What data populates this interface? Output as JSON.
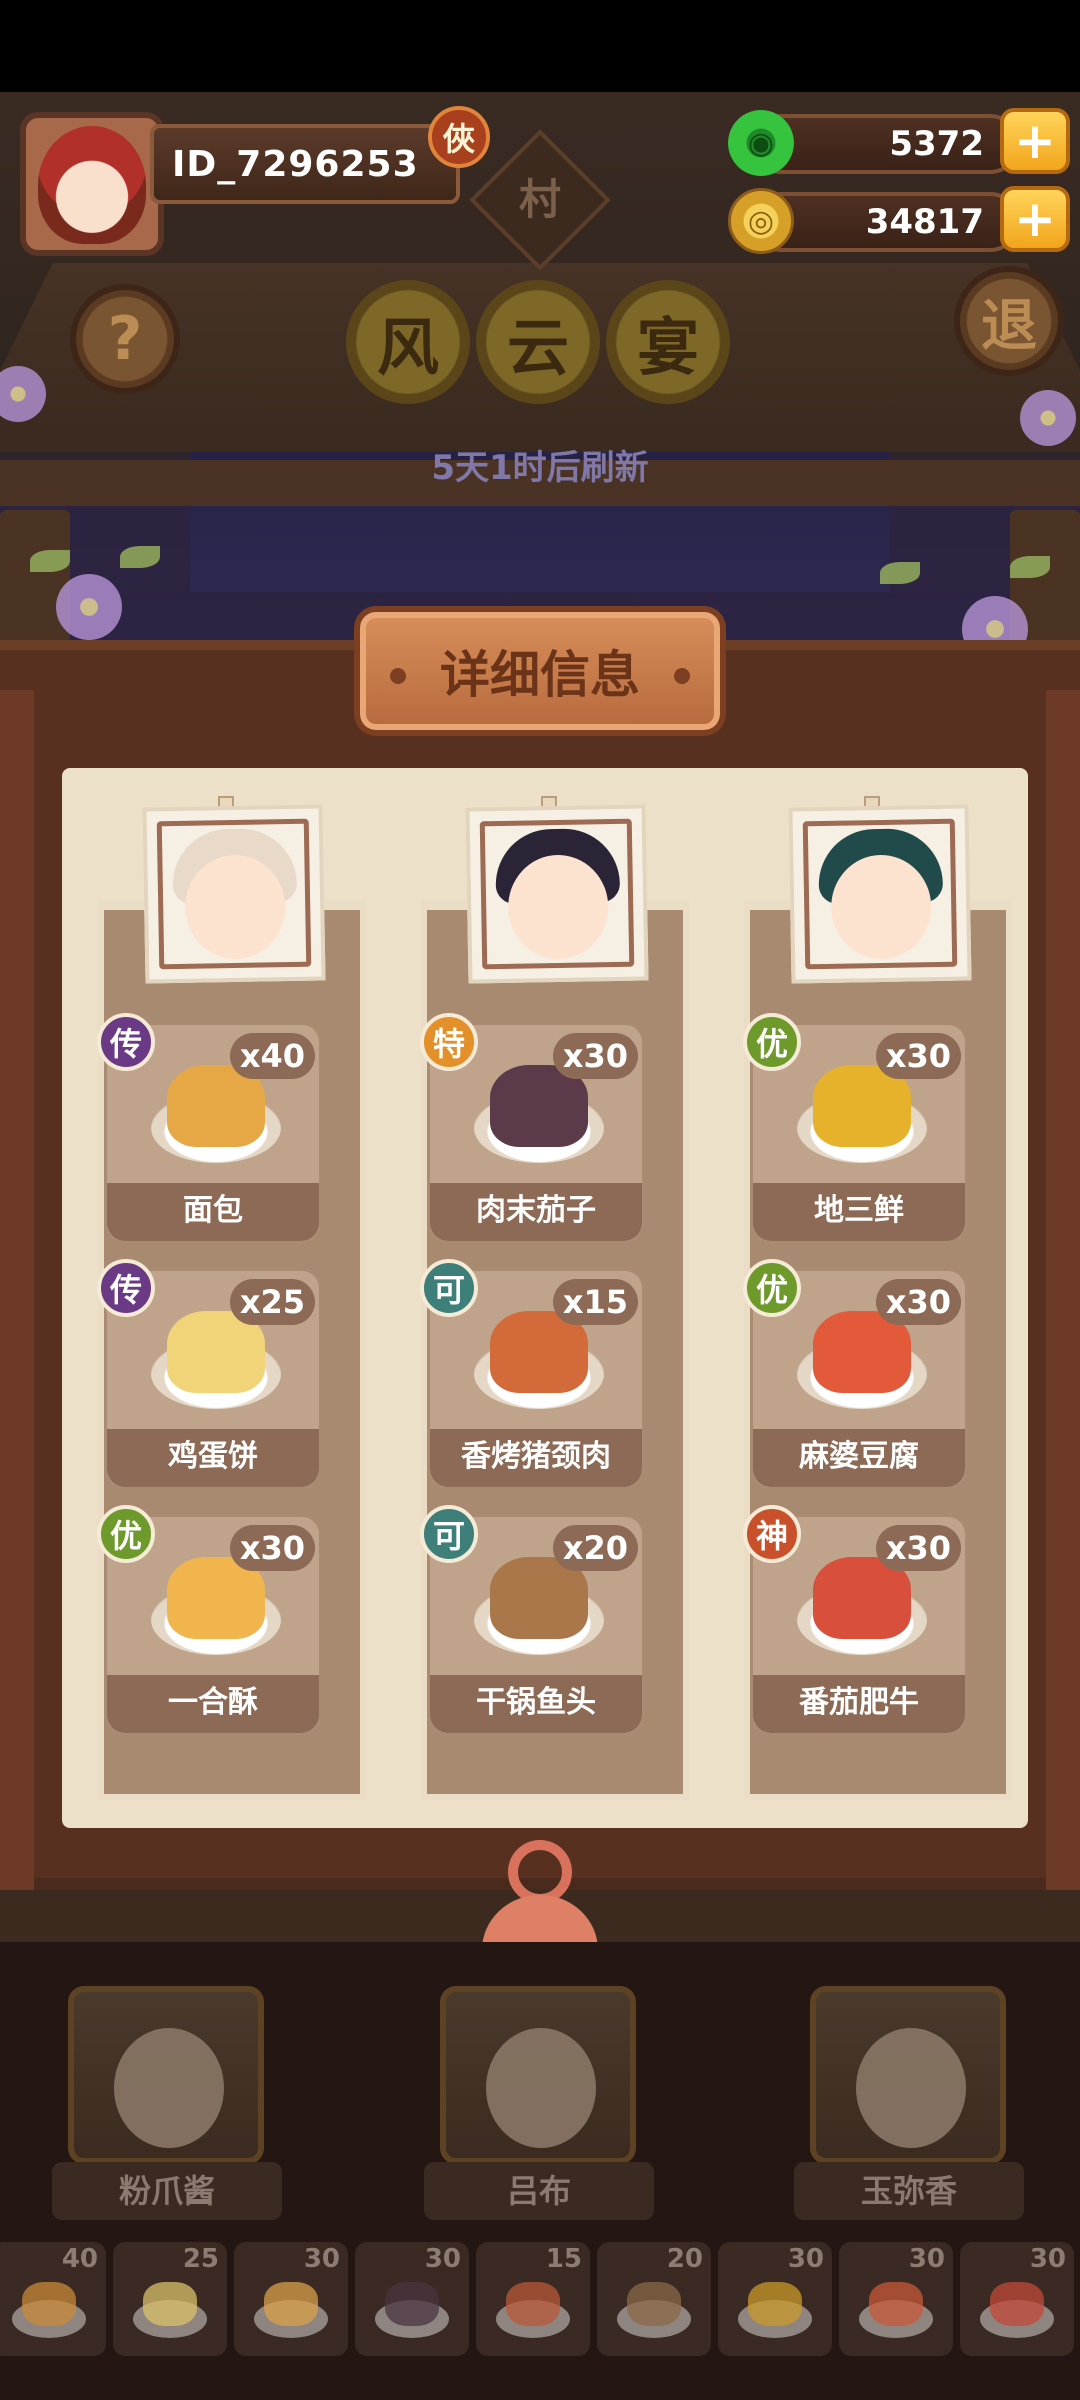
{
  "hud": {
    "player_id": "ID_7296253",
    "title_badge": "俠",
    "jade_count": "5372",
    "coin_count": "34817",
    "plus_label": "+",
    "help_label": "?",
    "exit_label": "退",
    "village_label": "村"
  },
  "event": {
    "title_chars": [
      "风",
      "云",
      "宴"
    ],
    "refresh_text": "5天1时后刷新"
  },
  "panel": {
    "header": "详细信息",
    "columns": [
      {
        "chef": "粉爪酱",
        "dishes": [
          {
            "grade": "传",
            "grade_color": "#6b3a85",
            "qty": "x40",
            "name": "面包",
            "food_color": "#e6a845"
          },
          {
            "grade": "传",
            "grade_color": "#6b3a85",
            "qty": "x25",
            "name": "鸡蛋饼",
            "food_color": "#f0d477"
          },
          {
            "grade": "优",
            "grade_color": "#6e9a2c",
            "qty": "x30",
            "name": "一合酥",
            "food_color": "#f1b54d"
          }
        ]
      },
      {
        "chef": "吕布",
        "dishes": [
          {
            "grade": "特",
            "grade_color": "#e3902a",
            "qty": "x30",
            "name": "肉末茄子",
            "food_color": "#5b3a4a"
          },
          {
            "grade": "可",
            "grade_color": "#3e7f7a",
            "qty": "x15",
            "name": "香烤猪颈肉",
            "food_color": "#d26a3a"
          },
          {
            "grade": "可",
            "grade_color": "#3e7f7a",
            "qty": "x20",
            "name": "干锅鱼头",
            "food_color": "#a9774a"
          }
        ]
      },
      {
        "chef": "玉弥香",
        "dishes": [
          {
            "grade": "优",
            "grade_color": "#6e9a2c",
            "qty": "x30",
            "name": "地三鲜",
            "food_color": "#e6b22c"
          },
          {
            "grade": "优",
            "grade_color": "#6e9a2c",
            "qty": "x30",
            "name": "麻婆豆腐",
            "food_color": "#e25a3a"
          },
          {
            "grade": "神",
            "grade_color": "#c8502a",
            "qty": "x30",
            "name": "番茄肥牛",
            "food_color": "#d8503c"
          }
        ]
      }
    ]
  },
  "dock": {
    "chefs": [
      "粉爪酱",
      "吕布",
      "玉弥香"
    ],
    "mini_dishes": [
      {
        "num": "40",
        "color": "#c98a3a"
      },
      {
        "num": "25",
        "color": "#d8c06a"
      },
      {
        "num": "30",
        "color": "#d9a04a"
      },
      {
        "num": "30",
        "color": "#4a3440"
      },
      {
        "num": "15",
        "color": "#b85a3a"
      },
      {
        "num": "20",
        "color": "#8a6a48"
      },
      {
        "num": "30",
        "color": "#c99a2a"
      },
      {
        "num": "30",
        "color": "#c85a3a"
      },
      {
        "num": "30",
        "color": "#c24a3a"
      }
    ]
  }
}
